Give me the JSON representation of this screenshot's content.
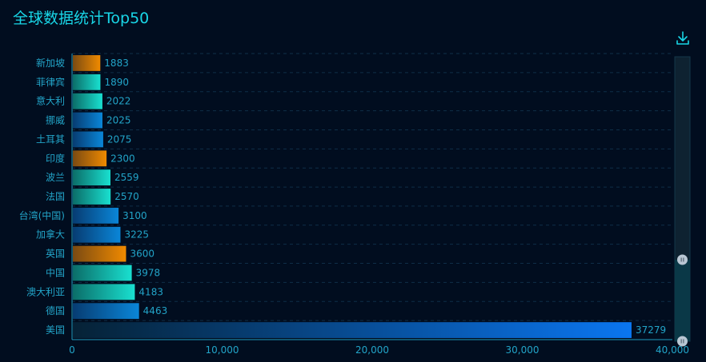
{
  "title": "全球数据统计Top50",
  "toolbox": {
    "download_icon": "download-icon"
  },
  "colors": {
    "title": "#19d6e7",
    "axis_text": "#22a4c8",
    "axis_line": "#1f9bbd",
    "gridline": "#0f2e48",
    "bar_orange": [
      "#7a4a12",
      "#f08a00"
    ],
    "bar_teal": [
      "#0b6d68",
      "#19e0d0"
    ],
    "bar_blue": [
      "#073c72",
      "#0a86d8"
    ],
    "bar_usa": [
      "#062236",
      "#0a76f0"
    ],
    "zoom_track": "#0a3b4a",
    "zoom_handle": "#b9c7d4"
  },
  "chart_data": {
    "type": "bar",
    "orientation": "horizontal",
    "title": "全球数据统计Top50",
    "categories": [
      "新加坡",
      "菲律宾",
      "意大利",
      "挪威",
      "土耳其",
      "印度",
      "波兰",
      "法国",
      "台湾(中国)",
      "加拿大",
      "英国",
      "中国",
      "澳大利亚",
      "德国",
      "美国"
    ],
    "values": [
      1883,
      1890,
      2022,
      2025,
      2075,
      2300,
      2559,
      2570,
      3100,
      3225,
      3600,
      3978,
      4183,
      4463,
      37279
    ],
    "bar_colors": [
      "orange",
      "teal",
      "teal",
      "blue",
      "blue",
      "orange",
      "teal",
      "teal",
      "blue",
      "blue",
      "orange",
      "teal",
      "teal",
      "blue",
      "usa"
    ],
    "xlim": [
      0,
      40000
    ],
    "xticks": [
      0,
      10000,
      20000,
      30000,
      40000
    ],
    "xtick_labels": [
      "0",
      "10,000",
      "20,000",
      "30,000",
      "40,000"
    ],
    "data_labels": [
      "1883",
      "1890",
      "2022",
      "2025",
      "2075",
      "2300",
      "2559",
      "2570",
      "3100",
      "3225",
      "3600",
      "3978",
      "4183",
      "4463",
      "37279"
    ],
    "grid": true,
    "datazoom": "vertical slider on right side"
  }
}
